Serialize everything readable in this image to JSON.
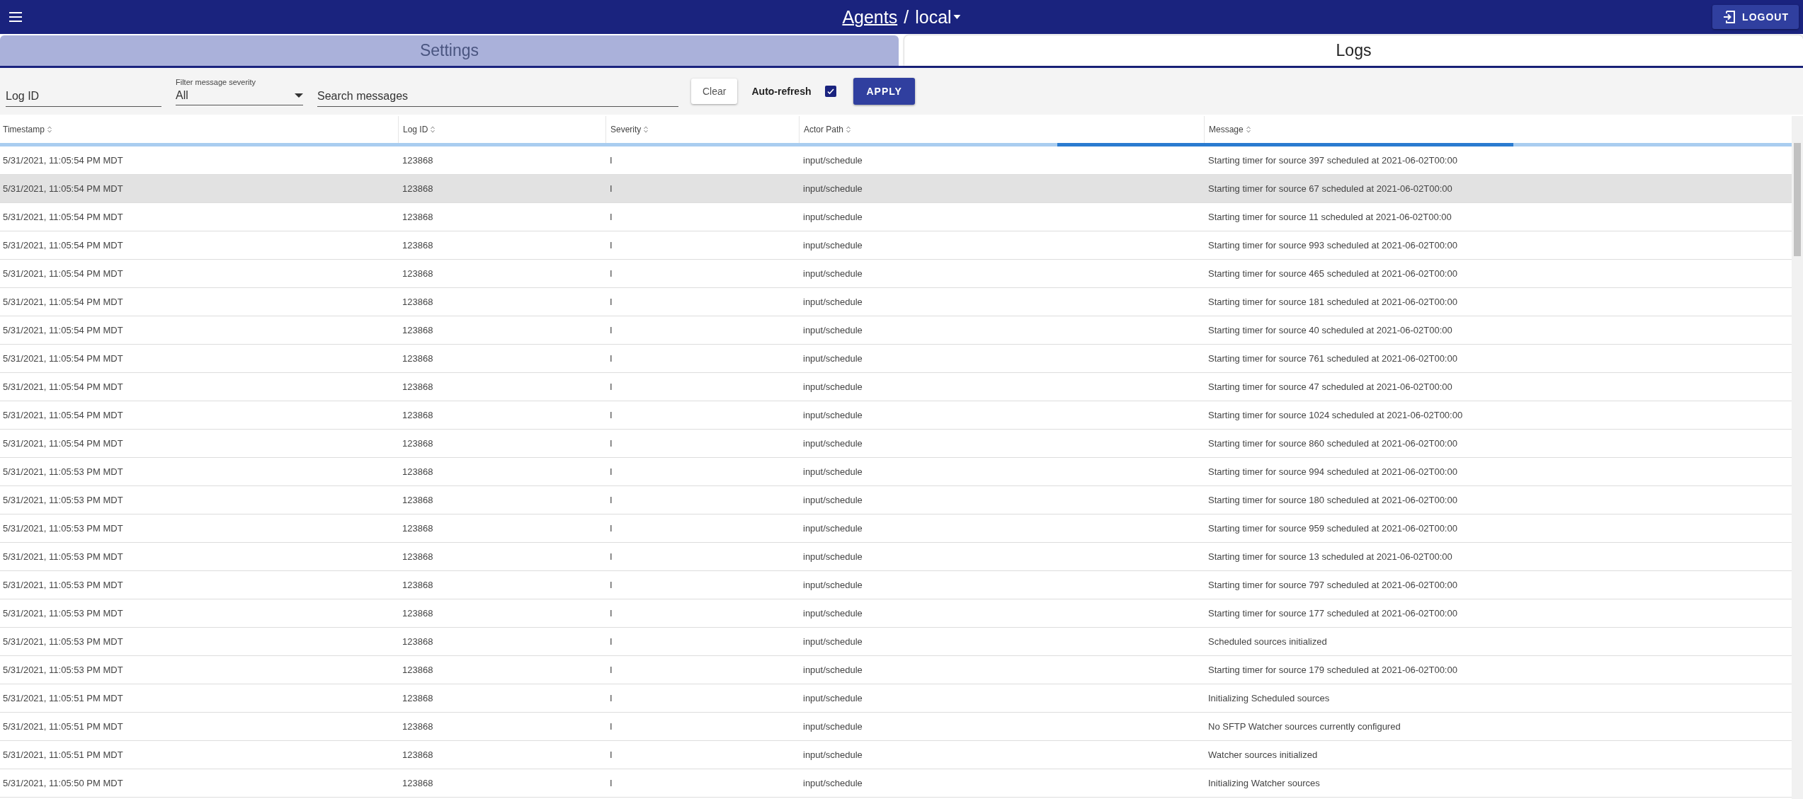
{
  "app_bar": {
    "breadcrumb_link": "Agents",
    "separator": "/",
    "current": "local",
    "logout": "LOGOUT"
  },
  "tabs": [
    {
      "label": "Settings",
      "selected": false
    },
    {
      "label": "Logs",
      "selected": true
    }
  ],
  "filters": {
    "log_id": {
      "placeholder": "Log ID"
    },
    "severity": {
      "label": "Filter message severity",
      "value": "All"
    },
    "search": {
      "placeholder": "Search messages"
    },
    "clear": "Clear",
    "auto_refresh": {
      "label": "Auto-refresh",
      "checked": true
    },
    "apply": "APPLY"
  },
  "table": {
    "loading": true,
    "columns": [
      "Timestamp",
      "Log ID",
      "Severity",
      "Actor Path",
      "Message"
    ],
    "rows": [
      {
        "cells": [
          "5/31/2021, 11:05:54 PM MDT",
          "123868",
          "I",
          "input/schedule",
          "Starting timer for source 397 scheduled at 2021-06-02T00:00"
        ],
        "selected": false
      },
      {
        "cells": [
          "5/31/2021, 11:05:54 PM MDT",
          "123868",
          "I",
          "input/schedule",
          "Starting timer for source 67 scheduled at 2021-06-02T00:00"
        ],
        "selected": true
      },
      {
        "cells": [
          "5/31/2021, 11:05:54 PM MDT",
          "123868",
          "I",
          "input/schedule",
          "Starting timer for source 11 scheduled at 2021-06-02T00:00"
        ],
        "selected": false
      },
      {
        "cells": [
          "5/31/2021, 11:05:54 PM MDT",
          "123868",
          "I",
          "input/schedule",
          "Starting timer for source 993 scheduled at 2021-06-02T00:00"
        ],
        "selected": false
      },
      {
        "cells": [
          "5/31/2021, 11:05:54 PM MDT",
          "123868",
          "I",
          "input/schedule",
          "Starting timer for source 465 scheduled at 2021-06-02T00:00"
        ],
        "selected": false
      },
      {
        "cells": [
          "5/31/2021, 11:05:54 PM MDT",
          "123868",
          "I",
          "input/schedule",
          "Starting timer for source 181 scheduled at 2021-06-02T00:00"
        ],
        "selected": false
      },
      {
        "cells": [
          "5/31/2021, 11:05:54 PM MDT",
          "123868",
          "I",
          "input/schedule",
          "Starting timer for source 40 scheduled at 2021-06-02T00:00"
        ],
        "selected": false
      },
      {
        "cells": [
          "5/31/2021, 11:05:54 PM MDT",
          "123868",
          "I",
          "input/schedule",
          "Starting timer for source 761 scheduled at 2021-06-02T00:00"
        ],
        "selected": false
      },
      {
        "cells": [
          "5/31/2021, 11:05:54 PM MDT",
          "123868",
          "I",
          "input/schedule",
          "Starting timer for source 47 scheduled at 2021-06-02T00:00"
        ],
        "selected": false
      },
      {
        "cells": [
          "5/31/2021, 11:05:54 PM MDT",
          "123868",
          "I",
          "input/schedule",
          "Starting timer for source 1024 scheduled at 2021-06-02T00:00"
        ],
        "selected": false
      },
      {
        "cells": [
          "5/31/2021, 11:05:54 PM MDT",
          "123868",
          "I",
          "input/schedule",
          "Starting timer for source 860 scheduled at 2021-06-02T00:00"
        ],
        "selected": false
      },
      {
        "cells": [
          "5/31/2021, 11:05:53 PM MDT",
          "123868",
          "I",
          "input/schedule",
          "Starting timer for source 994 scheduled at 2021-06-02T00:00"
        ],
        "selected": false
      },
      {
        "cells": [
          "5/31/2021, 11:05:53 PM MDT",
          "123868",
          "I",
          "input/schedule",
          "Starting timer for source 180 scheduled at 2021-06-02T00:00"
        ],
        "selected": false
      },
      {
        "cells": [
          "5/31/2021, 11:05:53 PM MDT",
          "123868",
          "I",
          "input/schedule",
          "Starting timer for source 959 scheduled at 2021-06-02T00:00"
        ],
        "selected": false
      },
      {
        "cells": [
          "5/31/2021, 11:05:53 PM MDT",
          "123868",
          "I",
          "input/schedule",
          "Starting timer for source 13 scheduled at 2021-06-02T00:00"
        ],
        "selected": false
      },
      {
        "cells": [
          "5/31/2021, 11:05:53 PM MDT",
          "123868",
          "I",
          "input/schedule",
          "Starting timer for source 797 scheduled at 2021-06-02T00:00"
        ],
        "selected": false
      },
      {
        "cells": [
          "5/31/2021, 11:05:53 PM MDT",
          "123868",
          "I",
          "input/schedule",
          "Starting timer for source 177 scheduled at 2021-06-02T00:00"
        ],
        "selected": false
      },
      {
        "cells": [
          "5/31/2021, 11:05:53 PM MDT",
          "123868",
          "I",
          "input/schedule",
          "Scheduled sources initialized"
        ],
        "selected": false
      },
      {
        "cells": [
          "5/31/2021, 11:05:53 PM MDT",
          "123868",
          "I",
          "input/schedule",
          "Starting timer for source 179 scheduled at 2021-06-02T00:00"
        ],
        "selected": false
      },
      {
        "cells": [
          "5/31/2021, 11:05:51 PM MDT",
          "123868",
          "I",
          "input/schedule",
          "Initializing Scheduled sources"
        ],
        "selected": false
      },
      {
        "cells": [
          "5/31/2021, 11:05:51 PM MDT",
          "123868",
          "I",
          "input/schedule",
          "No SFTP Watcher sources currently configured"
        ],
        "selected": false
      },
      {
        "cells": [
          "5/31/2021, 11:05:51 PM MDT",
          "123868",
          "I",
          "input/schedule",
          "Watcher sources initialized"
        ],
        "selected": false
      },
      {
        "cells": [
          "5/31/2021, 11:05:50 PM MDT",
          "123868",
          "I",
          "input/schedule",
          "Initializing Watcher sources"
        ],
        "selected": false
      }
    ]
  }
}
